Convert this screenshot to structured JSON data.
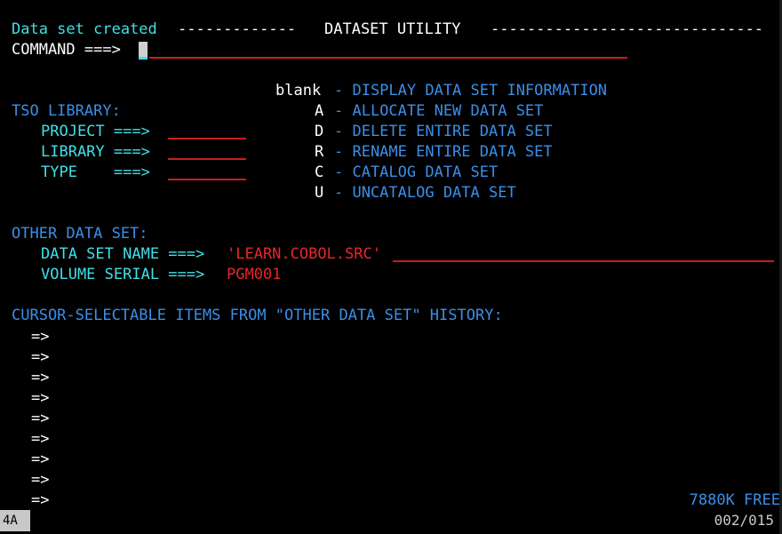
{
  "header": {
    "message": "Data set created",
    "left_rule": "-------------",
    "title": "DATASET UTILITY",
    "right_rule": "------------------------------"
  },
  "command": {
    "label": "COMMAND ===>",
    "value": ""
  },
  "options": [
    {
      "key": "blank",
      "desc": "- DISPLAY DATA SET INFORMATION"
    },
    {
      "key": "A",
      "desc": "- ALLOCATE NEW DATA SET"
    },
    {
      "key": "D",
      "desc": "- DELETE ENTIRE DATA SET"
    },
    {
      "key": "R",
      "desc": "- RENAME ENTIRE DATA SET"
    },
    {
      "key": "C",
      "desc": "- CATALOG DATA SET"
    },
    {
      "key": "U",
      "desc": "- UNCATALOG DATA SET"
    }
  ],
  "tso_library": {
    "heading": "TSO LIBRARY:",
    "project_label": "PROJECT ===>",
    "library_label": "LIBRARY ===>",
    "type_label": "TYPE    ===>",
    "project_value": "",
    "library_value": "",
    "type_value": ""
  },
  "other_dataset": {
    "heading": "OTHER DATA SET:",
    "dsn_label": "DATA SET NAME ===>",
    "dsn_value": "'LEARN.COBOL.SRC'",
    "volser_label": "VOLUME SERIAL ===>",
    "volser_value": "PGM001"
  },
  "history": {
    "heading": "CURSOR-SELECTABLE ITEMS FROM \"OTHER DATA SET\" HISTORY:",
    "arrow": "=>",
    "items": [
      "",
      "",
      "",
      "",
      "",
      "",
      "",
      "",
      ""
    ]
  },
  "free_space": "7880K FREE",
  "status": {
    "session": "4A",
    "cursor_pos": "002/015"
  }
}
